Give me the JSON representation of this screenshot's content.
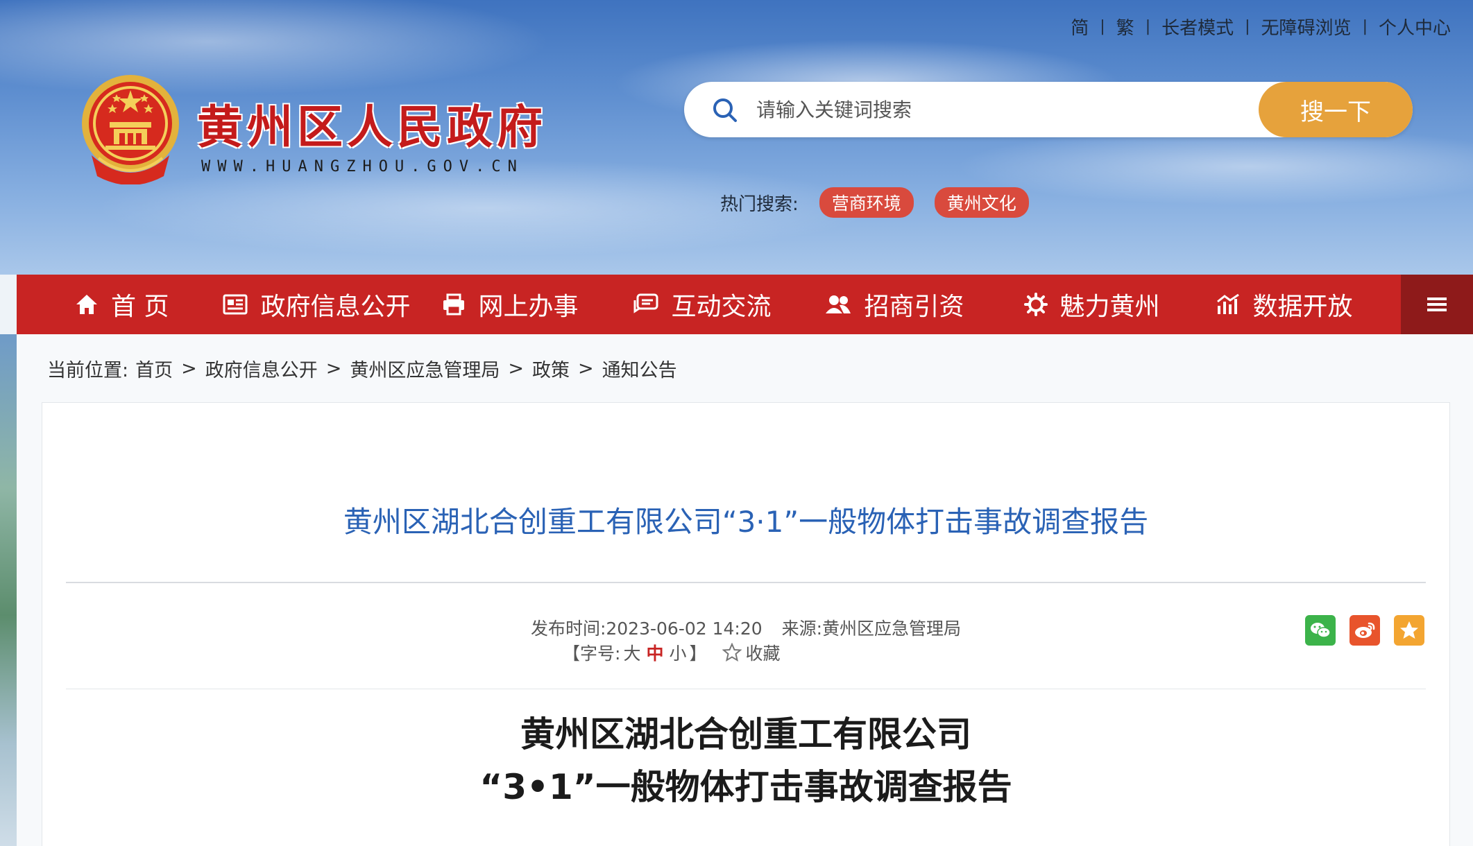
{
  "top_links": [
    "简",
    "繁",
    "长者模式",
    "无障碍浏览",
    "个人中心"
  ],
  "site": {
    "title": "黄州区人民政府",
    "url": "WWW.HUANGZHOU.GOV.CN"
  },
  "search": {
    "placeholder": "请输入关键词搜索",
    "value": "",
    "button_label": "搜一下"
  },
  "hot_search": {
    "label": "热门搜索:",
    "tags": [
      "营商环境",
      "黄州文化"
    ]
  },
  "nav": {
    "items": [
      {
        "label": "首 页",
        "icon": "home-icon"
      },
      {
        "label": "政府信息公开",
        "icon": "document-icon"
      },
      {
        "label": "网上办事",
        "icon": "printer-icon"
      },
      {
        "label": "互动交流",
        "icon": "chat-icon"
      },
      {
        "label": "招商引资",
        "icon": "users-icon"
      },
      {
        "label": "魅力黄州",
        "icon": "gear-icon"
      },
      {
        "label": "数据开放",
        "icon": "chart-icon"
      }
    ],
    "menu_icon": "hamburger-icon"
  },
  "breadcrumb": {
    "label": "当前位置:",
    "items": [
      "首页",
      "政府信息公开",
      "黄州区应急管理局",
      "政策",
      "通知公告"
    ],
    "separator": ">"
  },
  "article": {
    "title": "黄州区湖北合创重工有限公司“3·1”一般物体打击事故调查报告",
    "publish_label": "发布时间:",
    "publish_time": "2023-06-02 14:20",
    "source_label": "来源:",
    "source": "黄州区应急管理局",
    "font_size_label": "【字号:",
    "font_sizes": [
      "大",
      "中",
      "小"
    ],
    "font_size_close": "】",
    "favorite_label": "收藏",
    "share_icons": [
      "wechat-icon",
      "weibo-icon",
      "favorite-star-icon"
    ],
    "doc_title_line1": "黄州区湖北合创重工有限公司",
    "doc_title_line2": "“3•1”一般物体打击事故调查报告"
  },
  "colors": {
    "brand_red": "#c82423",
    "nav_menu_dark": "#8e1a1a",
    "search_button": "#e6a23c",
    "hot_tag": "#d94a3d",
    "article_title_blue": "#2a62b5",
    "wechat_green": "#3cb34a",
    "weibo_orange": "#e8542c",
    "star_orange": "#f3a531"
  }
}
